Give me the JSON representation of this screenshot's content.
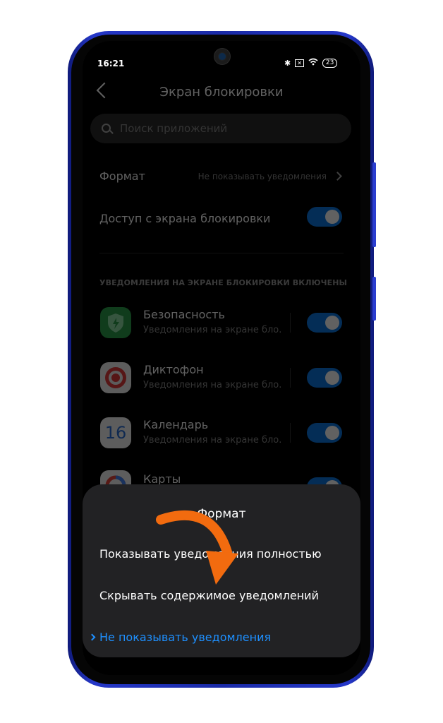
{
  "status_bar": {
    "time": "16:21",
    "bluetooth_icon": "bluetooth-icon",
    "sim_icon": "no-sim-icon",
    "wifi_icon": "wifi-icon",
    "battery": "23"
  },
  "header": {
    "title": "Экран блокировки",
    "back_icon": "arrow-left-icon"
  },
  "search": {
    "placeholder": "Поиск приложений"
  },
  "settings": {
    "format": {
      "label": "Формат",
      "value": "Не показывать уведомления"
    },
    "lock_access": {
      "label": "Доступ с экрана блокировки",
      "enabled": true
    }
  },
  "section_header": "УВЕДОМЛЕНИЯ НА ЭКРАНЕ БЛОКИРОВКИ ВКЛЮЧЕНЫ",
  "apps": [
    {
      "name": "Безопасность",
      "subtitle": "Уведомления на экране бло...",
      "icon": "shield-icon",
      "enabled": true
    },
    {
      "name": "Диктофон",
      "subtitle": "Уведомления на экране бло...",
      "icon": "recorder-icon",
      "enabled": true
    },
    {
      "name": "Календарь",
      "subtitle": "Уведомления на экране бло...",
      "icon": "calendar-icon",
      "icon_text": "16",
      "enabled": true
    },
    {
      "name": "Карты",
      "subtitle": "",
      "icon": "maps-icon",
      "enabled": true
    }
  ],
  "sheet": {
    "title": "Формат",
    "options": [
      {
        "label": "Показывать уведомления полностью",
        "selected": false
      },
      {
        "label": "Скрывать содержимое уведомлений",
        "selected": false
      },
      {
        "label": "Не показывать уведомления",
        "selected": true
      }
    ]
  },
  "colors": {
    "accent": "#1e90ff",
    "toggle_on": "#0b78e3",
    "annotation_arrow": "#f26b0f",
    "phone_frame": "#1a2aa6"
  }
}
